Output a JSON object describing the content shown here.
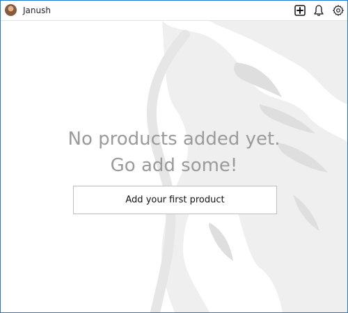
{
  "header": {
    "username": "Janush",
    "icons": [
      "add-product-icon",
      "bell-icon",
      "gear-icon"
    ]
  },
  "empty_state": {
    "line1": "No products added yet.",
    "line2": "Go add some!",
    "button_label": "Add your first product"
  },
  "colors": {
    "window_border": "#1f7bd1",
    "empty_text": "#9a9a9a",
    "background_art": "#eeeeee"
  }
}
